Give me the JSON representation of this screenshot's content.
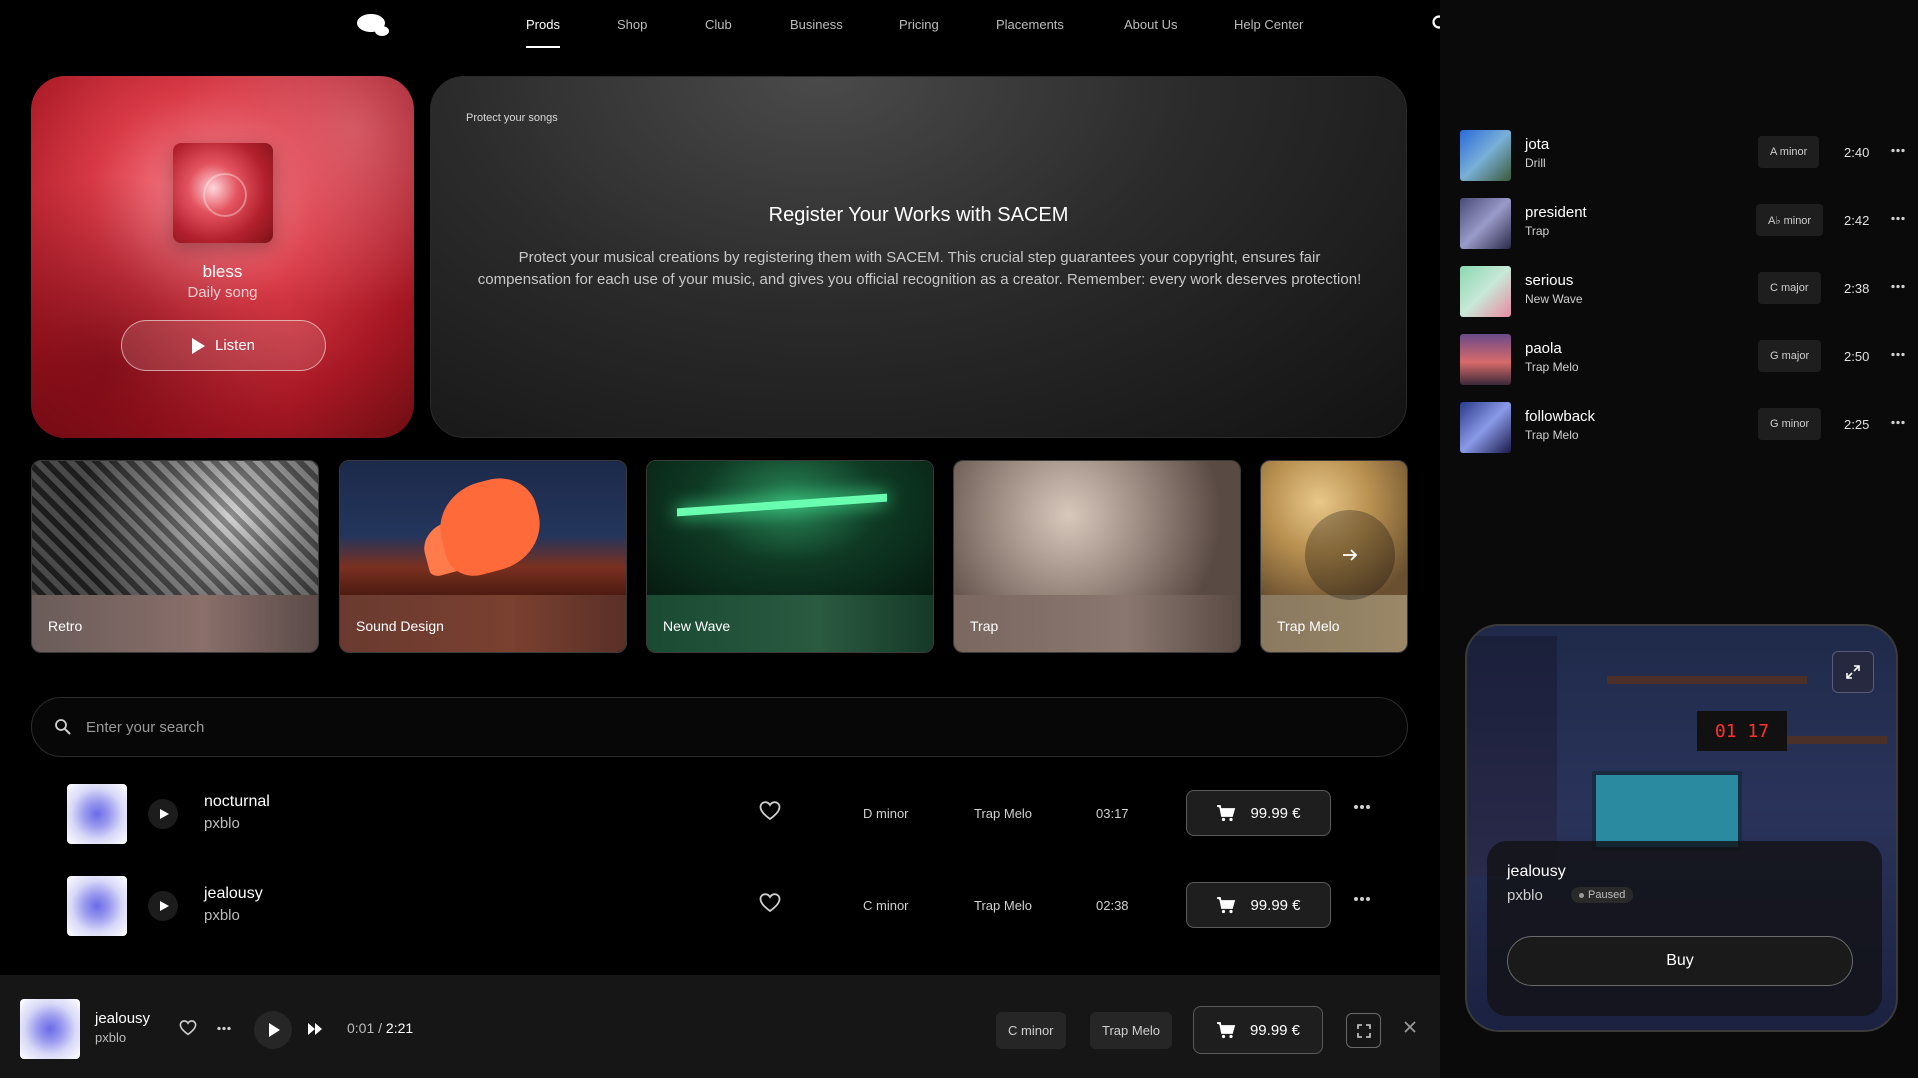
{
  "nav": {
    "links": [
      "Prods",
      "Shop",
      "Club",
      "Business",
      "Pricing",
      "Placements",
      "About Us",
      "Help Center"
    ],
    "active": "Prods",
    "cart_count": "0"
  },
  "daily": {
    "title": "bless",
    "subtitle": "Daily song",
    "listen_label": "Listen"
  },
  "info": {
    "eyebrow": "Protect your songs",
    "title": "Register Your Works with SACEM",
    "body": "Protect your musical creations by registering them with SACEM. This crucial step guarantees your copyright, ensures fair compensation for each use of your music, and gives you official recognition as a creator. Remember: every work deserves protection!"
  },
  "genres": [
    "Retro",
    "Sound Design",
    "New Wave",
    "Trap",
    "Trap Melo"
  ],
  "search": {
    "placeholder": "Enter your search"
  },
  "tracks": [
    {
      "title": "nocturnal",
      "artist": "pxblo",
      "key": "D minor",
      "genre": "Trap Melo",
      "duration": "03:17",
      "price": "99.99 €"
    },
    {
      "title": "jealousy",
      "artist": "pxblo",
      "key": "C minor",
      "genre": "Trap Melo",
      "duration": "02:38",
      "price": "99.99 €"
    }
  ],
  "player": {
    "title": "jealousy",
    "artist": "pxblo",
    "current_time": "0:01",
    "separator": "/",
    "total_time": "2:21",
    "key": "C minor",
    "genre": "Trap Melo",
    "price": "99.99 €"
  },
  "queue": [
    {
      "title": "jota",
      "genre": "Drill",
      "key": "A minor",
      "duration": "2:40",
      "color": "#3a6ab0"
    },
    {
      "title": "president",
      "genre": "Trap",
      "key": "A♭ minor",
      "duration": "2:42",
      "color": "#6a6a9a"
    },
    {
      "title": "serious",
      "genre": "New Wave",
      "key": "C major",
      "duration": "2:38",
      "color": "#5aa0a0"
    },
    {
      "title": "paola",
      "genre": "Trap Melo",
      "key": "G major",
      "duration": "2:50",
      "color": "#9a4a5a"
    },
    {
      "title": "followback",
      "genre": "Trap Melo",
      "key": "G minor",
      "duration": "2:25",
      "color": "#3a4a9a"
    }
  ],
  "now_playing": {
    "title": "jealousy",
    "artist": "pxblo",
    "status": "Paused",
    "clock": "01 17",
    "buy_label": "Buy"
  }
}
